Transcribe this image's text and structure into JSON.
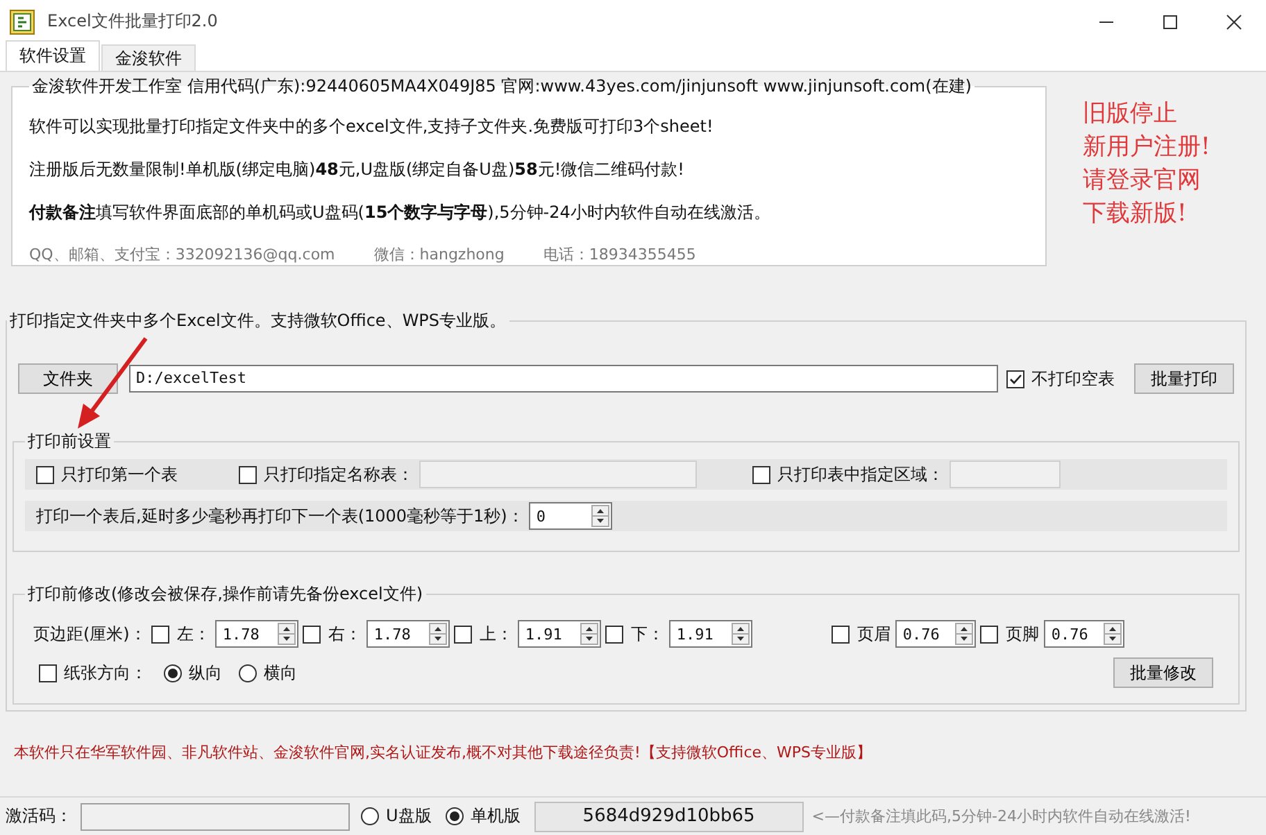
{
  "window": {
    "title": "Excel文件批量打印2.0"
  },
  "tabs": [
    {
      "label": "软件设置",
      "selected": true
    },
    {
      "label": "金浚软件",
      "selected": false
    }
  ],
  "info": {
    "legend": "金浚软件开发工作室 信用代码(广东):92440605MA4X049J85 官网:www.43yes.com/jinjunsoft  www.jinjunsoft.com(在建)",
    "lines": [
      "软件可以实现批量打印指定文件夹中的多个excel文件,支持子文件夹.免费版可打印3个sheet!",
      "注册版后无数量限制!单机版(绑定电脑)**48**元,U盘版(绑定自备U盘)**58**元!微信二维码付款!",
      "**付款备注**填写软件界面底部的单机码或U盘码(**15个数字与字母**),5分钟-24小时内软件自动在线激活。"
    ],
    "contacts": [
      "QQ、邮箱、支付宝：332092136@qq.com",
      "微信：hangzhong",
      "电话：18934355455"
    ]
  },
  "side_notice": [
    "旧版停止",
    "新用户注册!",
    "请登录官网",
    "下载新版!"
  ],
  "print_folder": {
    "legend": "打印指定文件夹中多个Excel文件。支持微软Office、WPS专业版。",
    "folder_button": "文件夹",
    "path": "D:/excelTest",
    "skip_empty": {
      "label": "不打印空表",
      "checked": true
    },
    "print_button": "批量打印"
  },
  "pre_settings": {
    "legend": "打印前设置",
    "options": [
      {
        "kind": "plain",
        "label": "只打印第一个表",
        "checked": false
      },
      {
        "kind": "field",
        "label": "只打印指定名称表：",
        "checked": false
      },
      {
        "kind": "field",
        "label": "只打印表中指定区域：",
        "checked": false
      }
    ],
    "delay": {
      "label": "打印一个表后,延时多少毫秒再打印下一个表(1000毫秒等于1秒)：",
      "value": "0"
    }
  },
  "modify": {
    "legend": "打印前修改(修改会被保存,操作前请先备份excel文件)",
    "margin_label": "页边距(厘米)：",
    "margins": [
      {
        "label": "左：",
        "checked": false,
        "value": "1.78"
      },
      {
        "label": "右：",
        "checked": false,
        "value": "1.78"
      },
      {
        "label": "上：",
        "checked": false,
        "value": "1.91"
      },
      {
        "label": "下：",
        "checked": false,
        "value": "1.91"
      }
    ],
    "header_footer": [
      {
        "label": "页眉",
        "checked": false,
        "value": "0.76"
      },
      {
        "label": "页脚",
        "checked": false,
        "value": "0.76"
      }
    ],
    "orientation": {
      "label": "纸张方向：",
      "checked": false,
      "options": [
        {
          "label": "纵向",
          "selected": true
        },
        {
          "label": "横向",
          "selected": false
        }
      ]
    },
    "apply_button": "批量修改"
  },
  "notice": "本软件只在华军软件园、非凡软件站、金浚软件官网,实名认证发布,概不对其他下载途径负责!【支持微软Office、WPS专业版】",
  "activation": {
    "label": "激活码：",
    "editions": [
      {
        "label": "U盘版",
        "selected": false
      },
      {
        "label": "单机版",
        "selected": true
      }
    ],
    "machine_code": "5684d929d10bb65",
    "hint": "<—付款备注填此码,5分钟-24小时内软件自动在线激活!"
  }
}
